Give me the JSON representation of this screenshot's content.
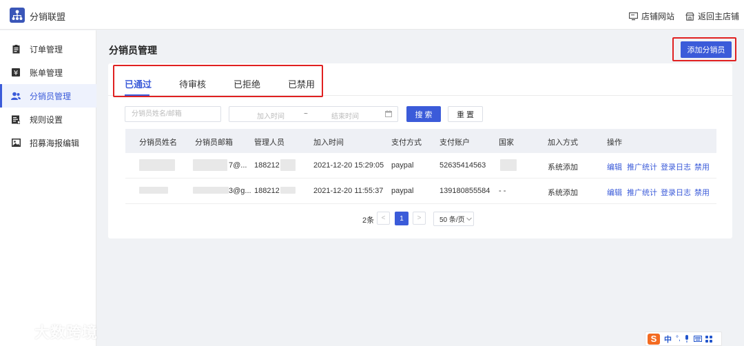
{
  "app": {
    "title": "分销联盟"
  },
  "header": {
    "store_site": "店铺网站",
    "back_to_store": "返回主店铺"
  },
  "sidebar": {
    "items": [
      {
        "label": "订单管理",
        "icon": "clipboard-icon"
      },
      {
        "label": "账单管理",
        "icon": "yen-icon"
      },
      {
        "label": "分销员管理",
        "icon": "users-icon",
        "active": true
      },
      {
        "label": "规则设置",
        "icon": "rules-icon"
      },
      {
        "label": "招募海报编辑",
        "icon": "image-icon"
      }
    ]
  },
  "page": {
    "title": "分销员管理",
    "add_button": "添加分销员"
  },
  "tabs": [
    "已通过",
    "待审核",
    "已拒绝",
    "已禁用"
  ],
  "filters": {
    "name_placeholder": "分销员姓名/邮箱",
    "start_placeholder": "加入时间",
    "separator": "~",
    "end_placeholder": "结束时间",
    "search_label": "搜 索",
    "reset_label": "重 置"
  },
  "table": {
    "headers": [
      "分销员姓名",
      "分销员邮箱",
      "管理人员",
      "加入时间",
      "支付方式",
      "支付账户",
      "国家",
      "加入方式",
      "操作"
    ],
    "rows": [
      {
        "email": "7@...",
        "manager": "188212",
        "joined": "2021-12-20 15:29:05",
        "pay_method": "paypal",
        "pay_account": "52635414563",
        "country": "",
        "join_method": "系统添加"
      },
      {
        "email": "3@g...",
        "manager": "188212",
        "joined": "2021-12-20 11:55:37",
        "pay_method": "paypal",
        "pay_account": "139180855584",
        "country": "- -",
        "join_method": "系统添加"
      }
    ],
    "actions": [
      "编辑",
      "推广统计",
      "登录日志",
      "禁用"
    ]
  },
  "pagination": {
    "total": "2条",
    "prev": "<",
    "current": "1",
    "next": ">",
    "page_size": "50 条/页"
  },
  "watermark": "大数跨境",
  "ime": {
    "mode": "中"
  },
  "colors": {
    "primary": "#3b5bd9",
    "highlight_frame": "#e02020"
  }
}
